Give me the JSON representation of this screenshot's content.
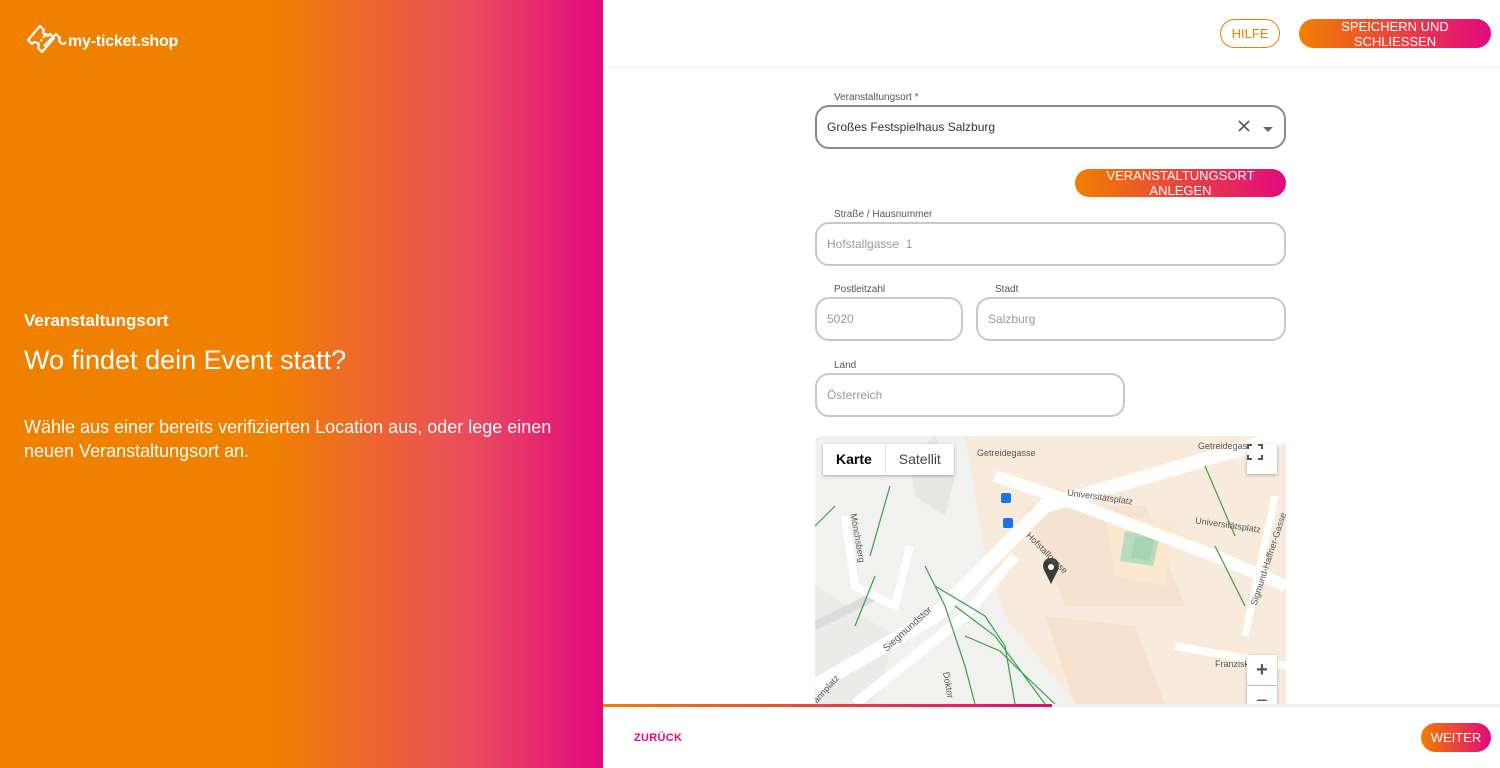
{
  "brand": {
    "name": "my-ticket.shop",
    "logo_icon": "ticket-icon",
    "colors": {
      "orange": "#f08000",
      "magenta": "#e2097e"
    }
  },
  "left": {
    "kicker": "Veranstaltungsort",
    "headline": "Wo findet dein Event statt?",
    "description": "Wähle aus einer bereits verifizierten Location aus, oder lege einen neuen Veranstaltungsort an."
  },
  "header": {
    "help_label": "HILFE",
    "save_close_label": "SPEICHERN UND SCHLIESSEN"
  },
  "form": {
    "venue": {
      "label": "Veranstaltungsort *",
      "value": "Großes Festspielhaus Salzburg",
      "clear_icon": "close-icon",
      "dropdown_icon": "caret-down-icon"
    },
    "create_venue_label": "VERANSTALTUNGSORT ANLEGEN",
    "street": {
      "label": "Straße / Hausnummer",
      "value": "Hofstallgasse  1"
    },
    "zip": {
      "label": "Postleitzahl",
      "value": "5020"
    },
    "city": {
      "label": "Stadt",
      "value": "Salzburg"
    },
    "country": {
      "label": "Land",
      "value": "Österreich"
    }
  },
  "map": {
    "tabs": [
      "Karte",
      "Satellit"
    ],
    "active_tab": "Karte",
    "streets": [
      "Getreidegasse",
      "Getreidegas",
      "Universitätsplatz",
      "Universitätsplatz",
      "Mönchsberg",
      "Hofstallgasse",
      "Sigmund-Haffner-Gasse",
      "Siegmundstor",
      "Franzisk",
      "Doktor",
      "annplatz"
    ],
    "controls": {
      "fullscreen_icon": "fullscreen-icon",
      "zoom_in": "+",
      "zoom_out": "−"
    },
    "marker_icon": "map-pin-icon"
  },
  "progress": {
    "fraction": 0.5
  },
  "footer": {
    "back_label": "ZURÜCK",
    "next_label": "WEITER"
  }
}
